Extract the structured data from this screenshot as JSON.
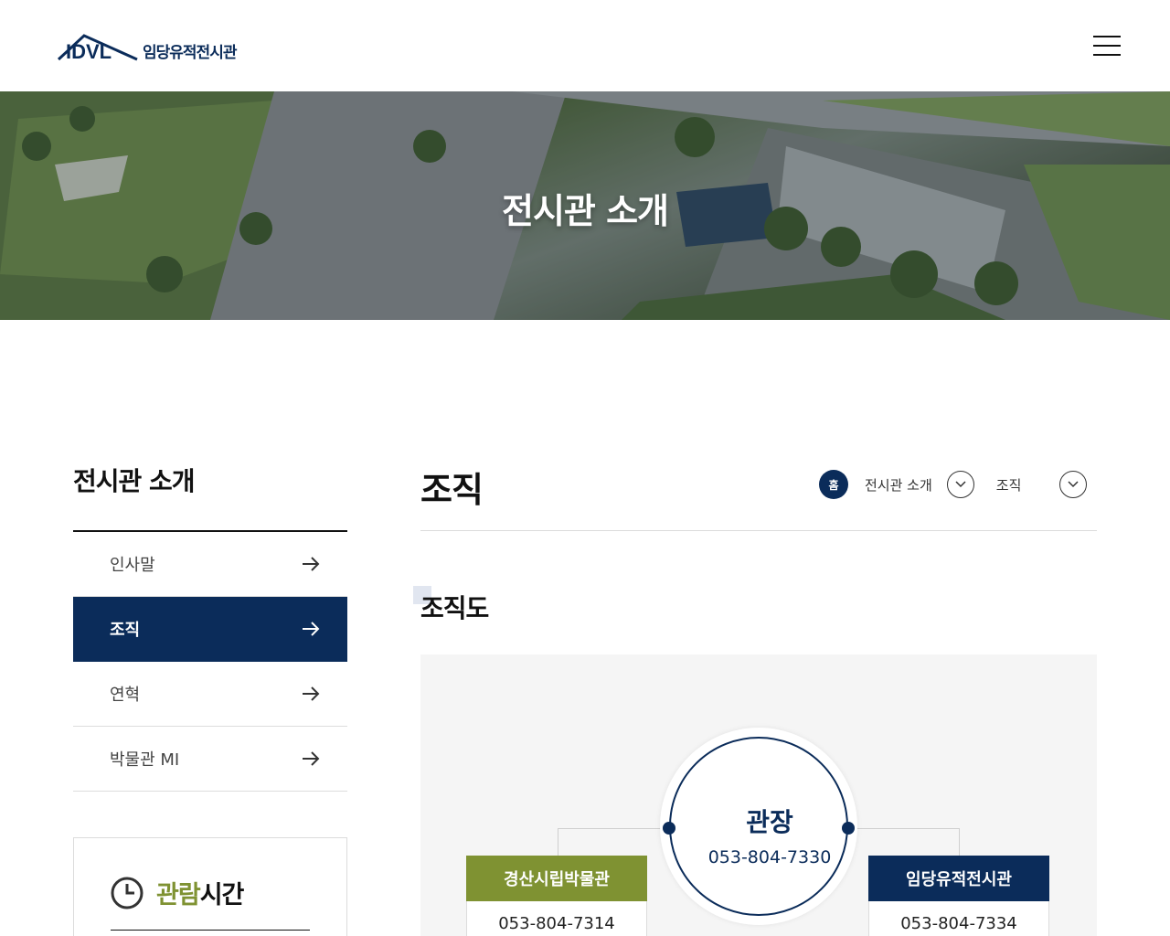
{
  "header": {
    "logo_mark": "IDVL",
    "logo_text": "임당유적전시관",
    "menu_icon": "hamburger-menu-icon"
  },
  "hero": {
    "title": "전시관 소개"
  },
  "sidebar": {
    "title": "전시관 소개",
    "items": [
      {
        "label": "인사말",
        "active": false
      },
      {
        "label": "조직",
        "active": true
      },
      {
        "label": "연혁",
        "active": false
      },
      {
        "label": "박물관 MI",
        "active": false
      }
    ],
    "hours": {
      "title_accent": "관람",
      "title_rest": "시간",
      "icon": "clock-icon"
    }
  },
  "main": {
    "page_title": "조직",
    "breadcrumb": {
      "home": "홈",
      "level1": "전시관 소개",
      "level2": "조직"
    },
    "section_title": "조직도",
    "org": {
      "head": {
        "title": "관장",
        "phone": "053-804-7330"
      },
      "left": {
        "name": "경산시립박물관",
        "phone": "053-804-7314"
      },
      "right": {
        "name": "임당유적전시관",
        "phone": "053-804-7334"
      }
    }
  },
  "colors": {
    "navy": "#0b2c5a",
    "olive": "#7f9232",
    "border": "#dcdcdc",
    "panel": "#f5f5f5"
  }
}
